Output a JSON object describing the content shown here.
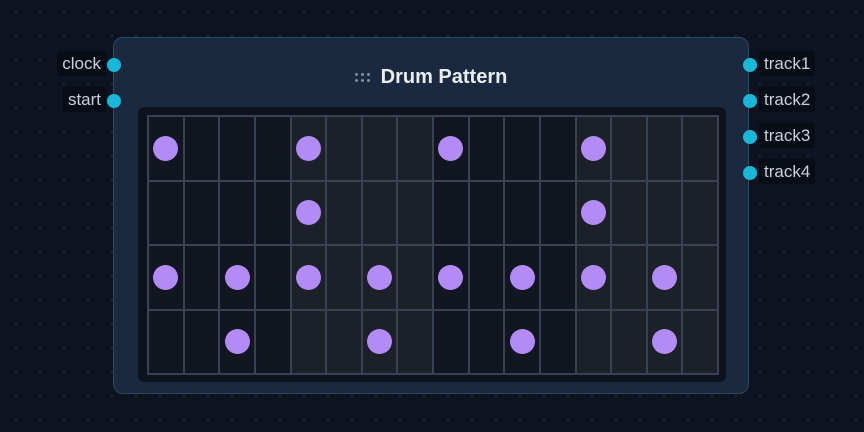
{
  "node": {
    "title": "Drum Pattern",
    "inputs": [
      "clock",
      "start"
    ],
    "outputs": [
      "track1",
      "track2",
      "track3",
      "track4"
    ]
  },
  "pattern": {
    "steps": 16,
    "rows": [
      [
        1,
        0,
        0,
        0,
        1,
        0,
        0,
        0,
        1,
        0,
        0,
        0,
        1,
        0,
        0,
        0
      ],
      [
        0,
        0,
        0,
        0,
        1,
        0,
        0,
        0,
        0,
        0,
        0,
        0,
        1,
        0,
        0,
        0
      ],
      [
        1,
        0,
        1,
        0,
        1,
        0,
        1,
        0,
        1,
        0,
        1,
        0,
        1,
        0,
        1,
        0
      ],
      [
        0,
        0,
        1,
        0,
        0,
        0,
        1,
        0,
        0,
        0,
        1,
        0,
        0,
        0,
        1,
        0
      ]
    ]
  },
  "colors": {
    "port": "#18b7d8",
    "active_step": "#b28bf5",
    "node_background": "#182940",
    "canvas_background": "#0d1320"
  },
  "icons": {
    "title_handle": "drag-handle-icon"
  }
}
